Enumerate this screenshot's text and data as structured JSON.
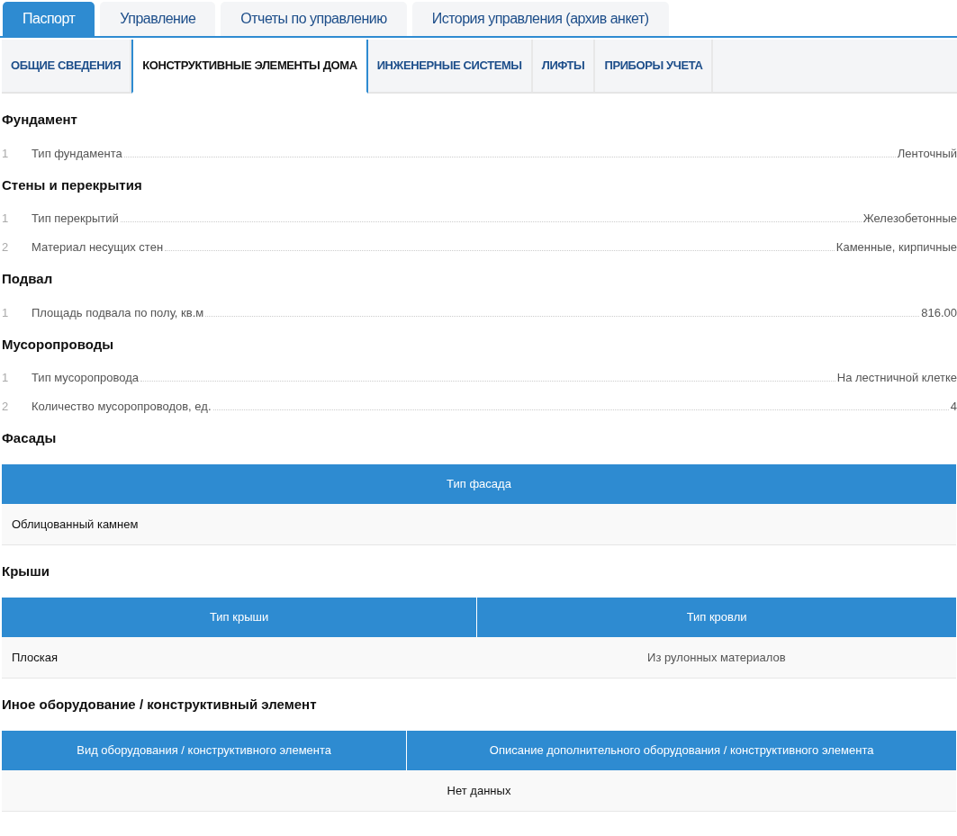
{
  "main_tabs": [
    {
      "label": "Паспорт",
      "selected": true
    },
    {
      "label": "Управление",
      "selected": false
    },
    {
      "label": "Отчеты по управлению",
      "selected": false
    },
    {
      "label": "История управления (архив анкет)",
      "selected": false
    }
  ],
  "sub_tabs": [
    {
      "label": "ОБЩИЕ СВЕДЕНИЯ",
      "selected": false
    },
    {
      "label": "КОНСТРУКТИВНЫЕ ЭЛЕМЕНТЫ ДОМА",
      "selected": true
    },
    {
      "label": "ИНЖЕНЕРНЫЕ СИСТЕМЫ",
      "selected": false
    },
    {
      "label": "ЛИФТЫ",
      "selected": false
    },
    {
      "label": "ПРИБОРЫ УЧЕТА",
      "selected": false
    }
  ],
  "sections": [
    {
      "kind": "list",
      "title": "Фундамент",
      "items": [
        {
          "number": "1",
          "label": "Тип фундамента",
          "value": "Ленточный"
        }
      ]
    },
    {
      "kind": "list",
      "title": "Стены и перекрытия",
      "items": [
        {
          "number": "1",
          "label": "Тип перекрытий",
          "value": "Железобетонные"
        },
        {
          "number": "2",
          "label": "Материал несущих стен",
          "value": "Каменные, кирпичные"
        }
      ]
    },
    {
      "kind": "list",
      "title": "Подвал",
      "items": [
        {
          "number": "1",
          "label": "Площадь подвала по полу, кв.м",
          "value": "816.00"
        }
      ]
    },
    {
      "kind": "list",
      "title": "Мусоропроводы",
      "items": [
        {
          "number": "1",
          "label": "Тип мусоропровода",
          "value": "На лестничной клетке"
        },
        {
          "number": "2",
          "label": "Количество мусоропроводов, ед.",
          "value": "4"
        }
      ]
    },
    {
      "kind": "table",
      "title": "Фасады",
      "columns": [
        "Тип фасада"
      ],
      "rows": [
        [
          "Облицованный камнем"
        ]
      ]
    },
    {
      "kind": "table",
      "title": "Крыши",
      "columns": [
        "Тип крыши",
        "Тип кровли"
      ],
      "rows": [
        [
          "Плоская",
          "Из рулонных материалов"
        ]
      ]
    },
    {
      "kind": "table",
      "title": "Иное оборудование / конструктивный элемент",
      "columns": [
        "Вид оборудования / конструктивного элемента",
        "Описание дополнительного оборудования / конструктивного элемента"
      ],
      "empty_message": "Нет данных"
    }
  ]
}
